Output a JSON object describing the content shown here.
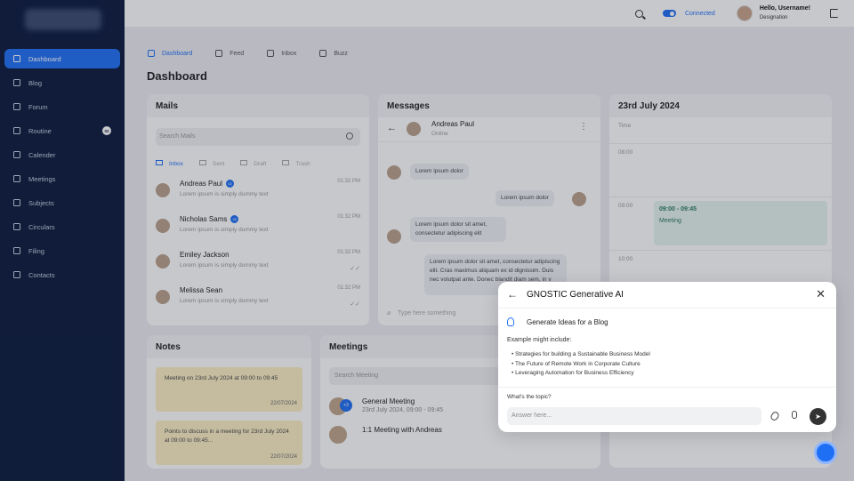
{
  "sidebar": {
    "items": [
      {
        "label": "Dashboard",
        "icon": "monitor-icon",
        "active": true
      },
      {
        "label": "Blog",
        "icon": "blog-icon"
      },
      {
        "label": "Forum",
        "icon": "forum-icon"
      },
      {
        "label": "Routine",
        "icon": "routine-icon",
        "badge": "02"
      },
      {
        "label": "Calender",
        "icon": "calendar-icon"
      },
      {
        "label": "Meetings",
        "icon": "meetings-icon"
      },
      {
        "label": "Subjects",
        "icon": "subjects-icon"
      },
      {
        "label": "Circulars",
        "icon": "circulars-icon"
      },
      {
        "label": "Filing",
        "icon": "filing-icon"
      },
      {
        "label": "Contacts",
        "icon": "contacts-icon"
      }
    ]
  },
  "topbar": {
    "status": "Connected",
    "greeting": "Hello, Username!",
    "designation": "Designation"
  },
  "tabs": [
    "Dashboard",
    "Feed",
    "Inbox",
    "Buzz"
  ],
  "page_title": "Dashboard",
  "mails": {
    "title": "Mails",
    "search_placeholder": "Search Mails",
    "tabs": [
      "Inbox",
      "Sent",
      "Draft",
      "Trash"
    ],
    "rows": [
      {
        "name": "Andreas Paul",
        "badge": "02",
        "preview": "Lorem ipsum is simply dummy text",
        "time": "01:32 PM"
      },
      {
        "name": "Nicholas Sams",
        "badge": "02",
        "preview": "Lorem ipsum is simply dummy text",
        "time": "01:32 PM"
      },
      {
        "name": "Emiley Jackson",
        "preview": "Lorem ipsum is simply dummy text",
        "time": "01:32 PM"
      },
      {
        "name": "Melissa Sean",
        "preview": "Lorem ipsum is simply dummy text",
        "time": "01:32 PM"
      }
    ]
  },
  "messages": {
    "title": "Messages",
    "contact": "Andreas Paul",
    "status": "Online",
    "bubbles": [
      "Lorem ipsum dolor",
      "Lorem ipsum dolor",
      "Lorem ipsum dolor sit amet, consectetur adipiscing elit",
      "Lorem ipsum dolor sit amet, consectetur adipiscing elit. Cras maximus aliquam ex id dignissim. Duis nec volutpat ante. Donec blandit diam sem, in v"
    ],
    "input_placeholder": "Type here something"
  },
  "calendar": {
    "title": "23rd July 2024",
    "time_header": "Time",
    "times": [
      "08:00",
      "09:00",
      "10:00"
    ],
    "event_time": "09:00 - 09:45",
    "event_name": "Meeting"
  },
  "notes": {
    "title": "Notes",
    "items": [
      {
        "text": "Meeting on 23rd July 2024 at 09:00 to 09:45",
        "date": "22/07/2024"
      },
      {
        "text": "Points to discuss in a meeting for 23rd July 2024 at 09:00 to 09:45...",
        "date": "22/07/2024"
      }
    ]
  },
  "meetings": {
    "title": "Meetings",
    "search_placeholder": "Search Meeting",
    "items": [
      {
        "name": "General Meeting",
        "time": "23rd July 2024, 09:00 - 09:45",
        "extra": "+3"
      },
      {
        "name": "1:1 Meeting with Andreas"
      }
    ]
  },
  "modal": {
    "title": "GNOSTIC Generative AI",
    "prompt": "Generate Ideas for a Blog",
    "example_label": "Example might include:",
    "examples": [
      "Strategies for building a Sustainable Business Model",
      "The Future of Remote Work in Corporate Culture",
      "Leveraging Automation for Business Efficiency"
    ],
    "topic_label": "What's the topic?",
    "answer_placeholder": "Answer here..."
  }
}
